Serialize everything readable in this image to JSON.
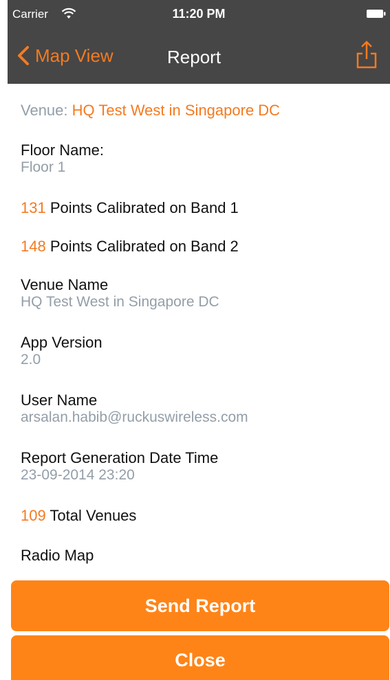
{
  "status_bar": {
    "carrier": "Carrier",
    "time": "11:20 PM"
  },
  "nav": {
    "back_label": "Map View",
    "title": "Report"
  },
  "report": {
    "venue_prefix": "Venue: ",
    "venue_value": "HQ Test West in Singapore DC",
    "floor_label": "Floor Name:",
    "floor_value": "Floor 1",
    "band1_count": "131",
    "band1_text": " Points Calibrated on Band 1",
    "band2_count": "148",
    "band2_text": " Points Calibrated on Band 2",
    "venue_name_label": "Venue Name",
    "venue_name_value": "HQ Test West in Singapore DC",
    "app_version_label": "App Version",
    "app_version_value": "2.0",
    "user_name_label": "User Name",
    "user_name_value": "arsalan.habib@ruckuswireless.com",
    "report_date_label": "Report Generation Date Time",
    "report_date_value": "23-09-2014 23:20",
    "total_venues_count": "109",
    "total_venues_text": " Total Venues",
    "radio_map_label": "Radio Map"
  },
  "buttons": {
    "send_label": "Send Report",
    "close_label": "Close"
  },
  "colors": {
    "accent": "#f47a20",
    "button": "#ff8417",
    "header": "#464646",
    "secondary_text": "#939ea8"
  },
  "icons": {
    "wifi": "wifi-icon",
    "battery": "battery-icon",
    "back": "chevron-left-icon",
    "share": "share-icon"
  }
}
